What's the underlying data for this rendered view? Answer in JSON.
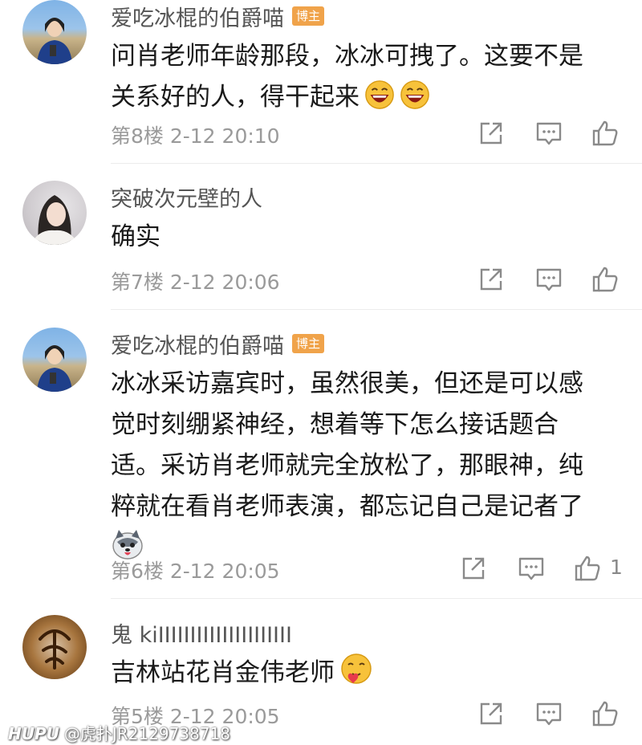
{
  "comments": [
    {
      "username": "爱吃冰棍的伯爵喵",
      "badge": "博主",
      "lines": [
        "问肖老师年龄那段，冰冰可拽了。这要不是",
        "关系好的人，得干起来"
      ],
      "emojis": [
        "laughing-emoji",
        "laughing-emoji"
      ],
      "meta": "第8楼 2-12 20:10",
      "likes": ""
    },
    {
      "username": "突破次元壁的人",
      "badge": "",
      "lines": [
        "确实"
      ],
      "meta": "第7楼 2-12 20:06",
      "likes": ""
    },
    {
      "username": "爱吃冰棍的伯爵喵",
      "badge": "博主",
      "lines": [
        "冰冰采访嘉宾时，虽然很美，但还是可以感",
        "觉时刻绷紧神经，想着等下怎么接话题合",
        "适。采访肖老师就完全放松了，那眼神，纯",
        "粹就在看肖老师表演，都忘记自己是记者了"
      ],
      "emojis": [
        "husky-emoji"
      ],
      "meta": "第6楼 2-12 20:05",
      "likes": "1"
    },
    {
      "username": "鬼 kiIIIIIIIIIIIIIIIIIIIII",
      "badge": "",
      "lines": [
        "吉林站花肖金伟老师"
      ],
      "emojis": [
        "heart-face-emoji"
      ],
      "meta": "第5楼 2-12 20:05",
      "likes": ""
    }
  ],
  "watermark": {
    "brand": "HUPU",
    "text": "@虎扑JR2129738718"
  },
  "colors": {
    "badge": "#f0a34a",
    "meta": "#9a9a9a",
    "icon": "#8a8a8a"
  },
  "icons": [
    "share-icon",
    "reply-icon",
    "like-icon"
  ]
}
